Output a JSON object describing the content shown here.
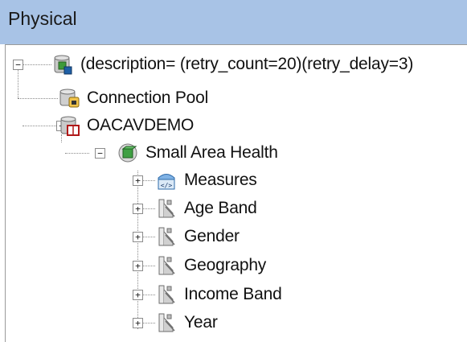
{
  "window": {
    "title": "Physical"
  },
  "tree": {
    "root": {
      "label": "(description= (retry_count=20)(retry_delay=3)",
      "icon": "database-green-icon",
      "expanded": true
    },
    "connection_pool": {
      "label": "Connection Pool",
      "icon": "connection-pool-icon"
    },
    "schema": {
      "label": "OACAVDEMO",
      "icon": "database-red-icon",
      "expanded": true
    },
    "subject": {
      "label": "Small Area Health",
      "icon": "cube-green-icon",
      "expanded": true
    },
    "children": [
      {
        "label": "Measures",
        "icon": "measures-cube-icon",
        "expanded": false
      },
      {
        "label": "Age Band",
        "icon": "hierarchy-icon",
        "expanded": false
      },
      {
        "label": "Gender",
        "icon": "hierarchy-icon",
        "expanded": false
      },
      {
        "label": "Geography",
        "icon": "hierarchy-icon",
        "expanded": false
      },
      {
        "label": "Income Band",
        "icon": "hierarchy-icon",
        "expanded": false
      },
      {
        "label": "Year",
        "icon": "hierarchy-icon",
        "expanded": false
      }
    ]
  },
  "colors": {
    "header_bg": "#a8c3e6",
    "panel_bg": "#ffffff"
  }
}
